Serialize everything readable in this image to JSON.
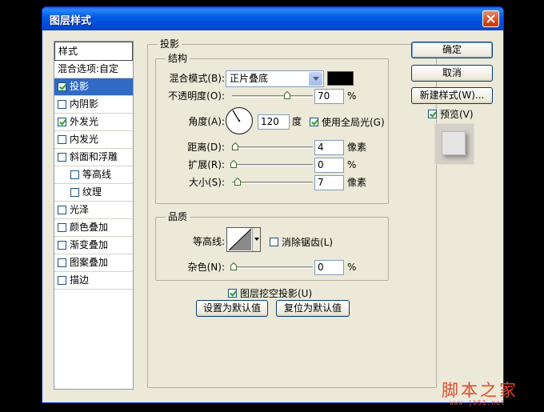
{
  "window": {
    "title": "图层样式"
  },
  "style_list": {
    "header": "样式",
    "items": [
      {
        "label": "混合选项:自定",
        "checkbox": false,
        "checked": false,
        "selected": false,
        "indent": false
      },
      {
        "label": "投影",
        "checkbox": true,
        "checked": true,
        "selected": true,
        "indent": false
      },
      {
        "label": "内阴影",
        "checkbox": true,
        "checked": false,
        "selected": false,
        "indent": false
      },
      {
        "label": "外发光",
        "checkbox": true,
        "checked": true,
        "selected": false,
        "indent": false
      },
      {
        "label": "内发光",
        "checkbox": true,
        "checked": false,
        "selected": false,
        "indent": false
      },
      {
        "label": "斜面和浮雕",
        "checkbox": true,
        "checked": false,
        "selected": false,
        "indent": false
      },
      {
        "label": "等高线",
        "checkbox": true,
        "checked": false,
        "selected": false,
        "indent": true
      },
      {
        "label": "纹理",
        "checkbox": true,
        "checked": false,
        "selected": false,
        "indent": true
      },
      {
        "label": "光泽",
        "checkbox": true,
        "checked": false,
        "selected": false,
        "indent": false
      },
      {
        "label": "颜色叠加",
        "checkbox": true,
        "checked": false,
        "selected": false,
        "indent": false
      },
      {
        "label": "渐变叠加",
        "checkbox": true,
        "checked": false,
        "selected": false,
        "indent": false
      },
      {
        "label": "图案叠加",
        "checkbox": true,
        "checked": false,
        "selected": false,
        "indent": false
      },
      {
        "label": "描边",
        "checkbox": true,
        "checked": false,
        "selected": false,
        "indent": false
      }
    ]
  },
  "panel": {
    "title": "投影",
    "structure": {
      "title": "结构",
      "blend_mode_label": "混合模式(B):",
      "blend_mode_value": "正片叠底",
      "shadow_color": "#000000",
      "opacity_label": "不透明度(O):",
      "opacity_value": "70",
      "opacity_unit": "%",
      "angle_label": "角度(A):",
      "angle_value": "120",
      "angle_unit": "度",
      "global_light_label": "使用全局光(G)",
      "global_light_checked": true,
      "distance_label": "距离(D):",
      "distance_value": "4",
      "distance_unit": "像素",
      "spread_label": "扩展(R):",
      "spread_value": "0",
      "spread_unit": "%",
      "size_label": "大小(S):",
      "size_value": "7",
      "size_unit": "像素"
    },
    "quality": {
      "title": "品质",
      "contour_label": "等高线:",
      "anti_alias_label": "消除锯齿(L)",
      "anti_alias_checked": false,
      "noise_label": "杂色(N):",
      "noise_value": "0",
      "noise_unit": "%"
    },
    "knockout_label": "图层挖空投影(U)",
    "knockout_checked": true,
    "make_default_label": "设置为默认值",
    "reset_default_label": "复位为默认值"
  },
  "buttons": {
    "ok": "确定",
    "cancel": "取消",
    "new_style": "新建样式(W)...",
    "preview_label": "预览(V)",
    "preview_checked": true
  },
  "watermark": {
    "text": "脚本之家",
    "url": "www.jb51.net"
  }
}
